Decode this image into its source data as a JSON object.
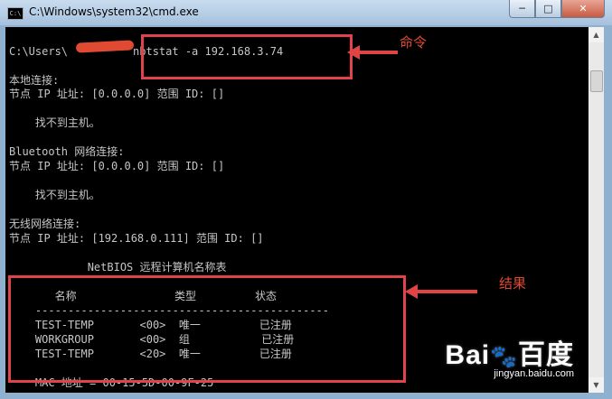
{
  "window": {
    "title": "C:\\Windows\\system32\\cmd.exe"
  },
  "console": {
    "lines": [
      {
        "prefix": "C:\\Users\\",
        "command": "nbtstat -a 192.168.3.74"
      },
      "本地连接:",
      "节点 IP 址址: [0.0.0.0] 范围 ID: []",
      "    找不到主机。",
      "Bluetooth 网络连接:",
      "节点 IP 址址: [0.0.0.0] 范围 ID: []",
      "    找不到主机。",
      "无线网络连接:",
      "节点 IP 址址: [192.168.0.111] 范围 ID: []",
      "            NetBIOS 远程计算机名称表",
      "       名称               类型         状态",
      "    ---------------------------------------------",
      "    TEST-TEMP       <00>  唯一         已注册",
      "    WORKGROUP       <00>  组           已注册",
      "    TEST-TEMP       <20>  唯一         已注册",
      "    MAC 地址 = 00-15-5D-00-9F-25"
    ]
  },
  "annotations": {
    "command_label": "命令",
    "result_label": "结果"
  },
  "watermark": {
    "logo": "Baiáè©åº¦",
    "site": "jingyan.baidu.com"
  },
  "colors": {
    "highlight": "#e0434c",
    "console_bg": "#000000",
    "console_text": "#c6c6c6"
  }
}
